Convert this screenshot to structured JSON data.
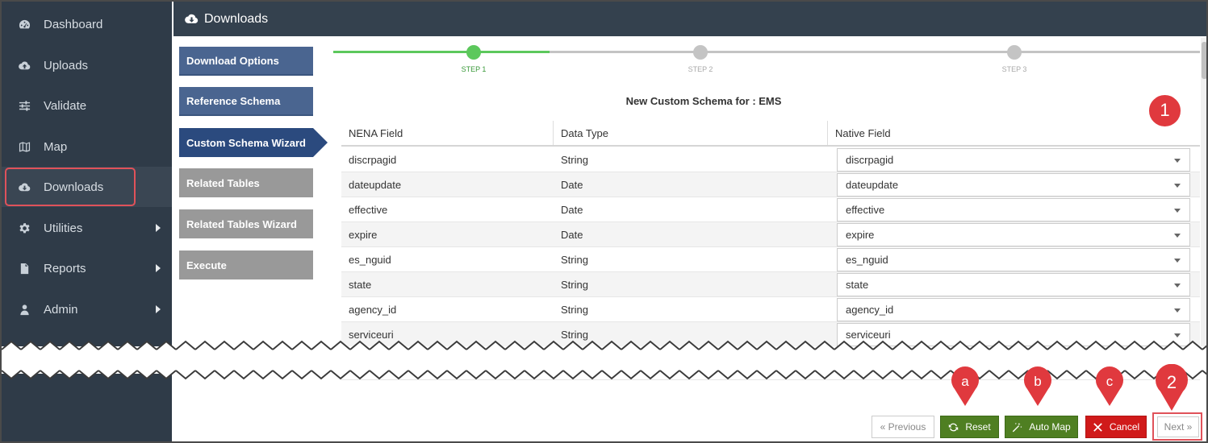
{
  "sidebar": {
    "items": [
      {
        "label": "Dashboard",
        "icon": "dashboard-icon"
      },
      {
        "label": "Uploads",
        "icon": "cloud-upload-icon"
      },
      {
        "label": "Validate",
        "icon": "sliders-icon"
      },
      {
        "label": "Map",
        "icon": "map-icon"
      },
      {
        "label": "Downloads",
        "icon": "cloud-download-icon",
        "active": true
      },
      {
        "label": "Utilities",
        "icon": "gear-icon",
        "submenu": true
      },
      {
        "label": "Reports",
        "icon": "file-icon",
        "submenu": true
      },
      {
        "label": "Admin",
        "icon": "user-icon",
        "submenu": true
      }
    ]
  },
  "header": {
    "title": "Downloads",
    "icon": "cloud-download-icon"
  },
  "wizard": {
    "steps": [
      {
        "label": "Download Options",
        "state": "done"
      },
      {
        "label": "Reference Schema",
        "state": "done"
      },
      {
        "label": "Custom Schema Wizard",
        "state": "current"
      },
      {
        "label": "Related Tables",
        "state": "pending"
      },
      {
        "label": "Related Tables Wizard",
        "state": "pending"
      },
      {
        "label": "Execute",
        "state": "pending"
      }
    ],
    "progress": {
      "labels": [
        "STEP 1",
        "STEP 2",
        "STEP 3"
      ],
      "active_color": "#5cc85c",
      "inactive_color": "#c4c4c4"
    }
  },
  "schema": {
    "title": "New Custom Schema for : EMS",
    "columns": [
      "NENA Field",
      "Data Type",
      "Native Field"
    ],
    "rows": [
      {
        "field": "discrpagid",
        "type": "String",
        "native": "discrpagid"
      },
      {
        "field": "dateupdate",
        "type": "Date",
        "native": "dateupdate"
      },
      {
        "field": "effective",
        "type": "Date",
        "native": "effective"
      },
      {
        "field": "expire",
        "type": "Date",
        "native": "expire"
      },
      {
        "field": "es_nguid",
        "type": "String",
        "native": "es_nguid"
      },
      {
        "field": "state",
        "type": "String",
        "native": "state"
      },
      {
        "field": "agency_id",
        "type": "String",
        "native": "agency_id"
      },
      {
        "field": "serviceuri",
        "type": "String",
        "native": "serviceuri"
      }
    ]
  },
  "footer": {
    "previous": "« Previous",
    "reset": "Reset",
    "auto_map": "Auto Map",
    "cancel": "Cancel",
    "next": "Next »"
  },
  "callouts": {
    "c1": "1",
    "c2": "2",
    "ca": "a",
    "cb": "b",
    "cc": "c",
    "color": "#e0393e"
  }
}
